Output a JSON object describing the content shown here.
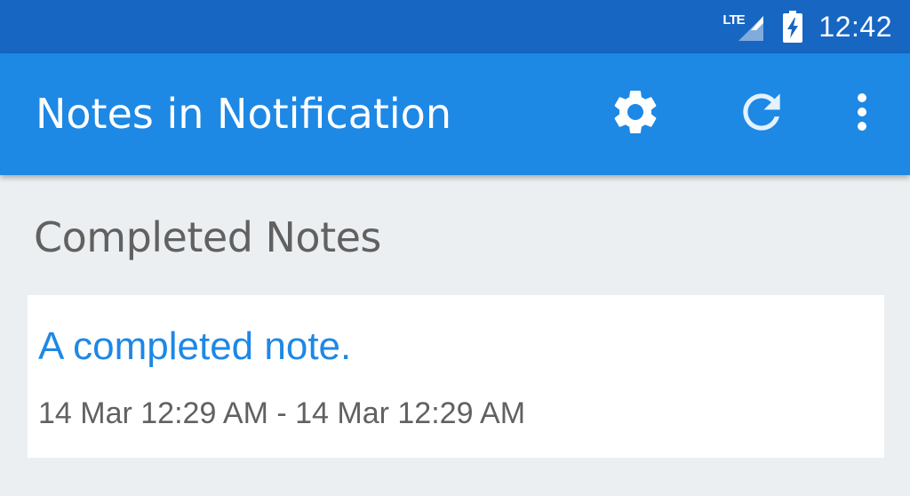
{
  "status_bar": {
    "network_label": "LTE",
    "time": "12:42",
    "signal_icon": "cell-signal-icon",
    "battery_icon": "battery-charging-icon"
  },
  "app_bar": {
    "title": "Notes in Notification",
    "actions": [
      {
        "icon": "gear-icon",
        "label": "Settings"
      },
      {
        "icon": "refresh-icon",
        "label": "Refresh"
      },
      {
        "icon": "more-vert-icon",
        "label": "More options"
      }
    ],
    "color": "#1E88E5"
  },
  "main": {
    "section_title": "Completed Notes",
    "notes": [
      {
        "title": "A completed note.",
        "time_range": "14 Mar 12:29 AM - 14 Mar 12:29 AM"
      }
    ]
  },
  "colors": {
    "status_bar": "#1666C2",
    "app_bar": "#1E88E5",
    "background": "#ECEFF1",
    "note_title": "#1E88E5",
    "secondary_text": "#616161"
  }
}
